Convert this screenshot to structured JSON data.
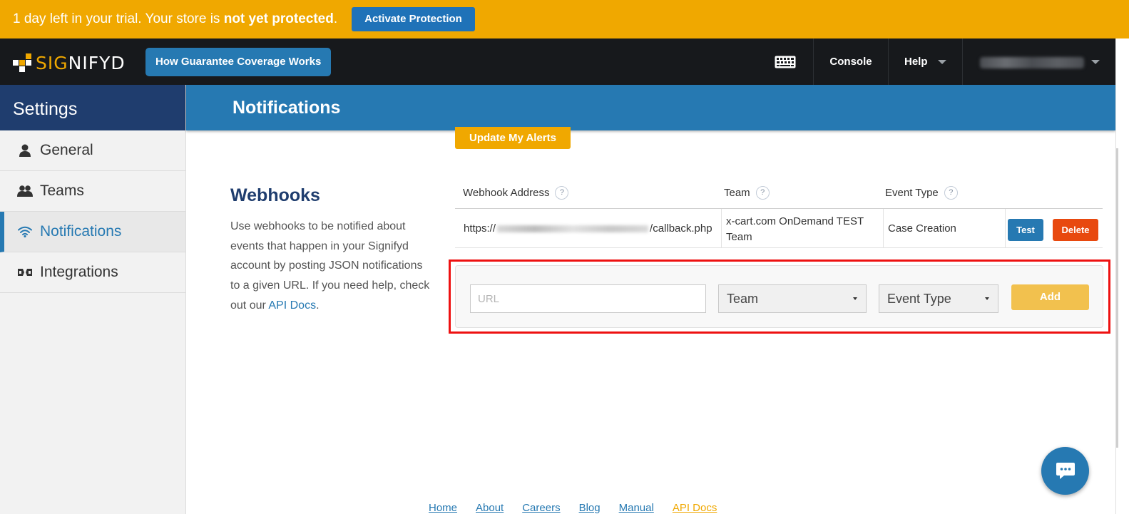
{
  "trial_banner": {
    "text_prefix": "1 day left in your trial. Your store is ",
    "text_bold": "not yet protected",
    "text_suffix": ".",
    "cta_label": "Activate Protection"
  },
  "topnav": {
    "logo_sig": "SIG",
    "logo_rest": "NIFYD",
    "guarantee_label": "How Guarantee Coverage Works",
    "console_label": "Console",
    "help_label": "Help",
    "keyboard_icon": "keyboard-icon"
  },
  "sidebar": {
    "title": "Settings",
    "items": [
      {
        "label": "General",
        "icon": "user-icon",
        "active": false
      },
      {
        "label": "Teams",
        "icon": "team-icon",
        "active": false
      },
      {
        "label": "Notifications",
        "icon": "wifi-icon",
        "active": true
      },
      {
        "label": "Integrations",
        "icon": "integration-icon",
        "active": false
      }
    ]
  },
  "page": {
    "title": "Notifications",
    "update_alerts_label": "Update My Alerts"
  },
  "webhooks": {
    "title": "Webhooks",
    "desc_before_link": "Use webhooks to be notified about events that happen in your Signifyd account by posting JSON notifications to a given URL. If you need help, check out our ",
    "desc_link": "API Docs",
    "desc_after_link": ".",
    "columns": [
      "Webhook Address",
      "Team",
      "Event Type"
    ],
    "help_glyph": "?",
    "rows": [
      {
        "address_prefix": "https://",
        "address_suffix": "/callback.php",
        "team": "x-cart.com OnDemand TEST Team",
        "event_type": "Case Creation",
        "test_label": "Test",
        "delete_label": "Delete"
      }
    ],
    "add_form": {
      "url_placeholder": "URL",
      "team_select": "Team",
      "event_select": "Event Type",
      "add_label": "Add"
    }
  },
  "footer": {
    "links": [
      "Home",
      "About",
      "Careers",
      "Blog",
      "Manual",
      "API Docs"
    ]
  },
  "colors": {
    "banner": "#f0a800",
    "primary_blue": "#2679b2",
    "sidebar_head": "#1f3d6e",
    "delete_red": "#e8490f",
    "highlight_red": "#ee1111"
  }
}
